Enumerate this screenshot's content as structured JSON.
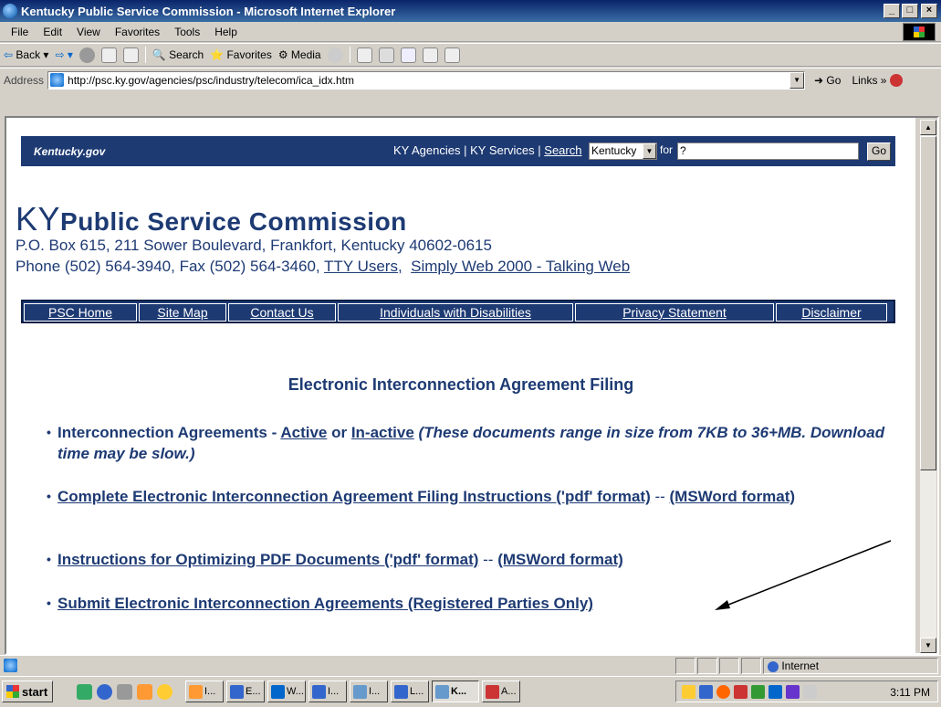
{
  "window": {
    "title": "Kentucky Public Service Commission - Microsoft Internet Explorer",
    "min": "_",
    "max": "□",
    "close": "×"
  },
  "menu": [
    "File",
    "Edit",
    "View",
    "Favorites",
    "Tools",
    "Help"
  ],
  "toolbar": {
    "back": "Back",
    "search": "Search",
    "favorites": "Favorites",
    "media": "Media"
  },
  "address": {
    "label": "Address",
    "url": "http://psc.ky.gov/agencies/psc/industry/telecom/ica_idx.htm",
    "go": "Go",
    "links": "Links"
  },
  "kygov": {
    "logo": "Kentucky.gov",
    "agencies": "KY Agencies",
    "services": "KY Services",
    "search": "Search",
    "scope": "Kentucky",
    "for": "for",
    "query": "?",
    "go": "Go"
  },
  "psc": {
    "ky": "KY",
    "name": "Public Service Commission",
    "address1": "P.O. Box 615, 211 Sower Boulevard, Frankfort, Kentucky 40602-0615",
    "phone": "Phone (502) 564-3940, Fax (502) 564-3460,",
    "tty": "TTY Users,",
    "simply": "Simply Web 2000 - Talking Web"
  },
  "nav": [
    "PSC Home",
    "Site Map",
    "Contact Us",
    "Individuals with Disabilities",
    "Privacy Statement",
    "Disclaimer"
  ],
  "heading": "Electronic Interconnection Agreement Filing",
  "items": {
    "i1": {
      "pre": "Interconnection Agreements - ",
      "active": "Active",
      "or": " or ",
      "inactive": "In-active",
      "note": " (These documents range in size from 7KB to 36+MB. Download time may be slow.)"
    },
    "i2": {
      "pdf": "Complete Electronic Interconnection Agreement Filing Instructions ('pdf' format)",
      "sep": " -- ",
      "word": "(MSWord format)"
    },
    "i3": {
      "pdf": "Instructions for Optimizing PDF Documents ('pdf' format)",
      "sep": " -- ",
      "word": "(MSWord format)"
    },
    "i4": {
      "link": "Submit Electronic Interconnection Agreements (Registered Parties Only)"
    }
  },
  "status": {
    "zone": "Internet"
  },
  "taskbar": {
    "start": "start",
    "tasks": [
      "I...",
      "E...",
      "W...",
      "I...",
      "I...",
      "L...",
      "K...",
      "A..."
    ],
    "clock": "3:11 PM"
  }
}
